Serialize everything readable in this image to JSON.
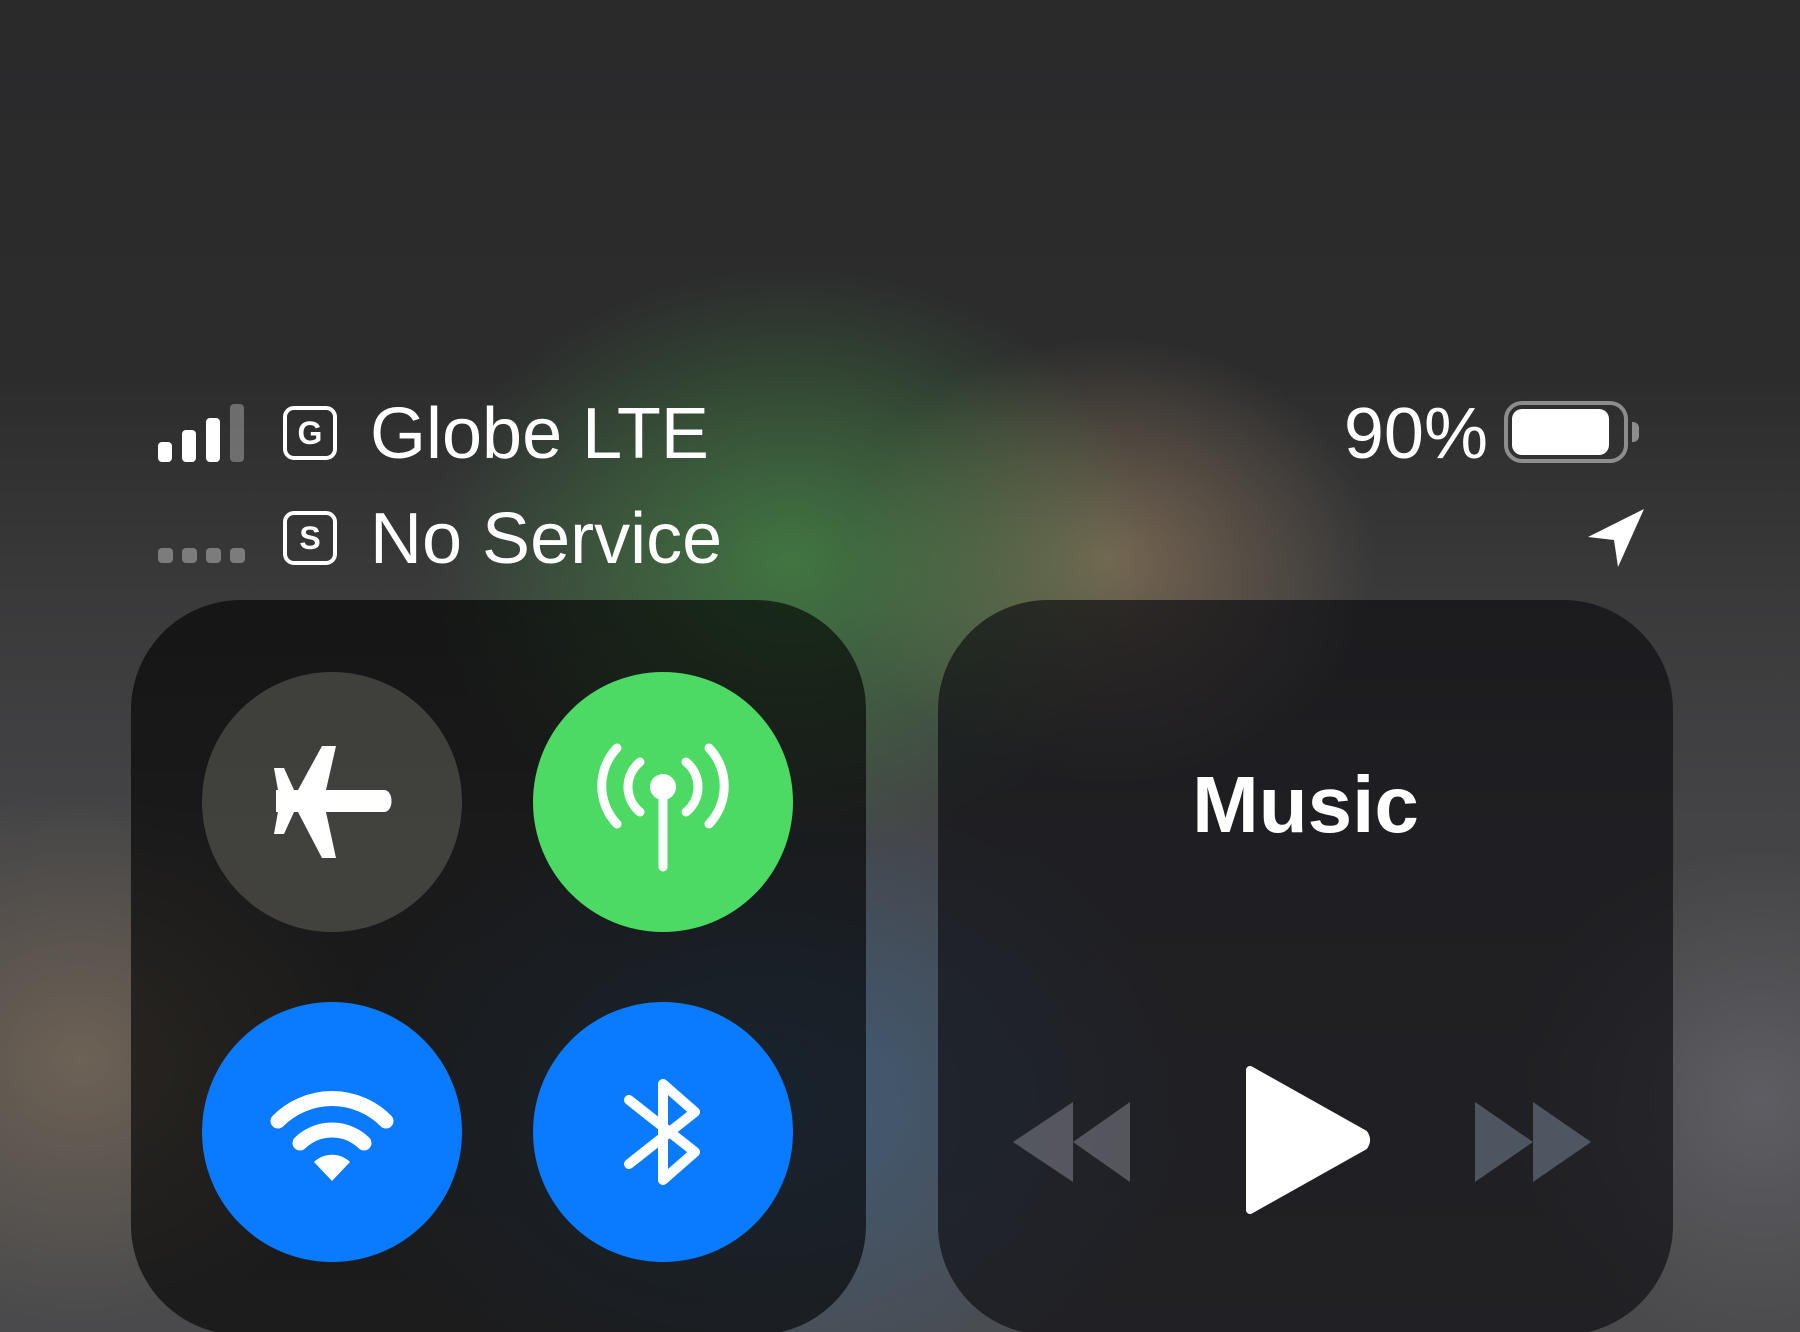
{
  "status_bar": {
    "primary_line": {
      "signal_bars_filled": 3,
      "signal_bars_total": 4,
      "sim_label": "G",
      "carrier": "Globe LTE"
    },
    "secondary_line": {
      "signal_dots": 4,
      "sim_label": "S",
      "carrier": "No Service"
    },
    "battery_percent_text": "90%",
    "battery_level": 0.9,
    "location_icon": "location-arrow-icon"
  },
  "connectivity": {
    "airplane_mode": {
      "icon": "airplane-icon",
      "on": false
    },
    "cellular_data": {
      "icon": "cellular-antenna-icon",
      "on": true,
      "color": "#4cd964"
    },
    "wifi": {
      "icon": "wifi-icon",
      "on": true,
      "color": "#0a7aff"
    },
    "bluetooth": {
      "icon": "bluetooth-icon",
      "on": true,
      "color": "#0a7aff"
    }
  },
  "music": {
    "title": "Music",
    "controls": {
      "rewind": "rewind-icon",
      "play": "play-icon",
      "forward": "fast-forward-icon"
    }
  }
}
